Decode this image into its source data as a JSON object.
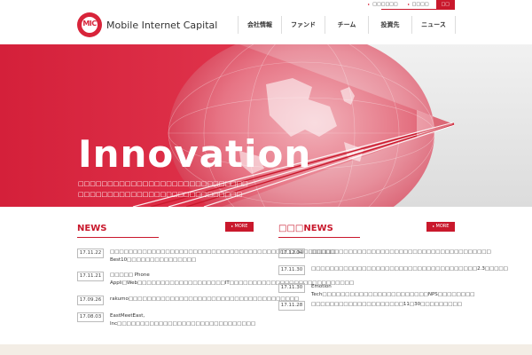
{
  "header": {
    "logo_mark": "MIC",
    "logo_text": "Mobile Internet Capital",
    "util_links": [
      {
        "label": "□□□□□□"
      },
      {
        "label": "□□□□"
      },
      {
        "label": "□□"
      }
    ],
    "nav": [
      {
        "label": "会社情報"
      },
      {
        "label": "ファンド"
      },
      {
        "label": "チーム"
      },
      {
        "label": "投資先"
      },
      {
        "label": "ニュース"
      }
    ]
  },
  "hero": {
    "title": "Innovation",
    "subtitle_lines": [
      "□□□□□□□□□□□□□□□□□□□□□□□□□□□□□",
      "□□□□□□□□□□□□□□□□□□□□□□□□□□□□"
    ]
  },
  "colors": {
    "brand_red": "#c9182c",
    "hero_red": "#d8243a"
  },
  "news": {
    "title": "NEWS",
    "more_label": "MORE",
    "items": [
      {
        "date": "17.11.22",
        "text": "□□□□□□□□□□□□□□□□□□□□□□□□□□□□□□□□□□□□□□□□□□□□□□□□□ Best10□□□□□□□□□□□□□□□"
      },
      {
        "date": "17.11.21",
        "text": "□□□□□ Phone Appli□Web□□□□□□□□□□□□□□□□□□□IT□□□□□□□□□□□□□□□□□□□□□□□□□□□"
      },
      {
        "date": "17.09.26",
        "text": "rakumo□□□□□□□□□□□□□□□□□□□□□□□□□□□□□□□□□□□□□"
      },
      {
        "date": "17.08.03",
        "text": "EastMeetEast, Inc□□□□□□□□□□□□□□□□□□□□□□□□□□□□□□"
      }
    ]
  },
  "portfolio_news": {
    "title": "□□□NEWS",
    "more_label": "MORE",
    "items": [
      {
        "date": "17.12.04",
        "text": "□□□□□□□□□□□□□□□□□□□□□□□□□□□□□□□□□□□□□□□"
      },
      {
        "date": "17.11.30",
        "text": "□□□□□□□□□□□□□□□□□□□□□□□□□□□□□□□□□□□□2.3□□□□□"
      },
      {
        "date": "17.11.30",
        "text": "Emotion Tech□□□□□□□□□□□□□□□□□□□□□□□NPS□□□□□□□□"
      },
      {
        "date": "17.11.28",
        "text": "□□□□□□□□□□□□□□□□□□□□11□30□□□□□□□□□"
      }
    ]
  }
}
